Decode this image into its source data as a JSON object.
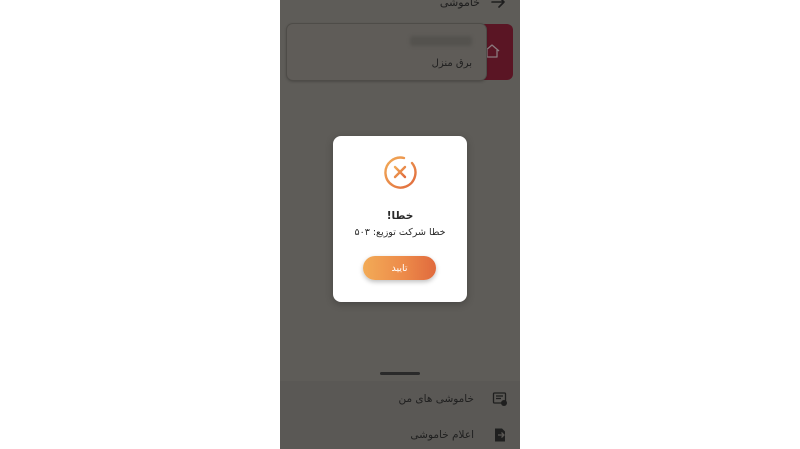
{
  "header": {
    "title": "خاموشی",
    "back_icon": "arrow-right-icon"
  },
  "account_card": {
    "name": "برق منزل",
    "icon": "home-icon",
    "accent_color": "#5a1524"
  },
  "bottom_menu": {
    "items": [
      {
        "label": "خاموشی های من",
        "icon": "outage-list-icon"
      },
      {
        "label": "اعلام خاموشی",
        "icon": "report-outage-icon"
      }
    ]
  },
  "dialog": {
    "icon": "error-x-icon",
    "title": "خطا!",
    "message": "خطا شرکت توزیع: ۵۰۳",
    "confirm_label": "تایید",
    "accent_gradient": [
      "#f2ab57",
      "#e06a3d"
    ]
  }
}
